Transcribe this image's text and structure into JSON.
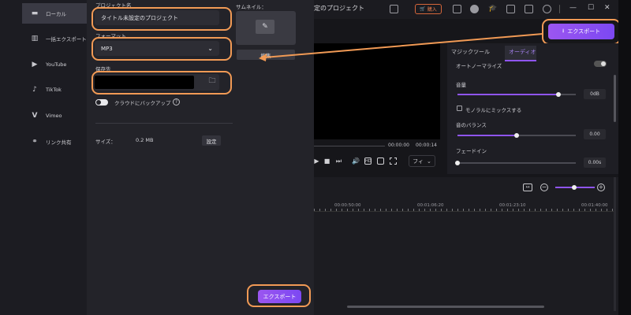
{
  "editor": {
    "project_title": "定のプロジェクト",
    "buy_label": "購入",
    "export_label": "エクスポート",
    "time_current": "00:00:00",
    "time_total": "00:00:14",
    "fit_label": "フィ",
    "tabs": [
      {
        "label": "マジックツール",
        "active": false
      },
      {
        "label": "オーディオ",
        "active": true
      }
    ],
    "audio": {
      "normalize_label": "オートノーマライズ",
      "volume_label": "音量",
      "volume_value": "0dB",
      "volume_level": 0.85,
      "mono_label": "モノラルにミックスする",
      "balance_label": "音のバランス",
      "balance_value": "0.00",
      "balance_level": 0.5,
      "fade_in_label": "フェードイン",
      "fade_in_value": "0.00s",
      "fade_in_level": 0.0
    },
    "ruler_ticks": [
      "00:00:50:00",
      "00:01:06:20",
      "00:01:23:10",
      "00:01:40:00"
    ]
  },
  "dialog": {
    "sidebar": [
      {
        "label": "ローカル",
        "icon": "monitor-icon",
        "active": true
      },
      {
        "label": "一括エクスポート",
        "icon": "batch-icon",
        "active": false
      },
      {
        "label": "YouTube",
        "icon": "youtube-icon",
        "active": false
      },
      {
        "label": "TikTok",
        "icon": "tiktok-icon",
        "active": false
      },
      {
        "label": "Vimeo",
        "icon": "vimeo-icon",
        "active": false
      },
      {
        "label": "リンク共有",
        "icon": "link-icon",
        "active": false
      }
    ],
    "project_name_label": "プロジェクト名",
    "project_name_value": "タイトル未設定のプロジェクト",
    "format_label": "フォーマット",
    "format_value": "MP3",
    "save_to_label": "保存先",
    "cloud_backup_label": "クラウドにバックアップ",
    "size_label": "サイズ：",
    "size_value": "0.2 MB",
    "settings_label": "設定",
    "thumbnail_label": "サムネイル：",
    "edit_label": "編集",
    "export_label": "エクスポート"
  },
  "colors": {
    "accent": "#8f55ef",
    "highlight_ring": "#f19a55"
  }
}
